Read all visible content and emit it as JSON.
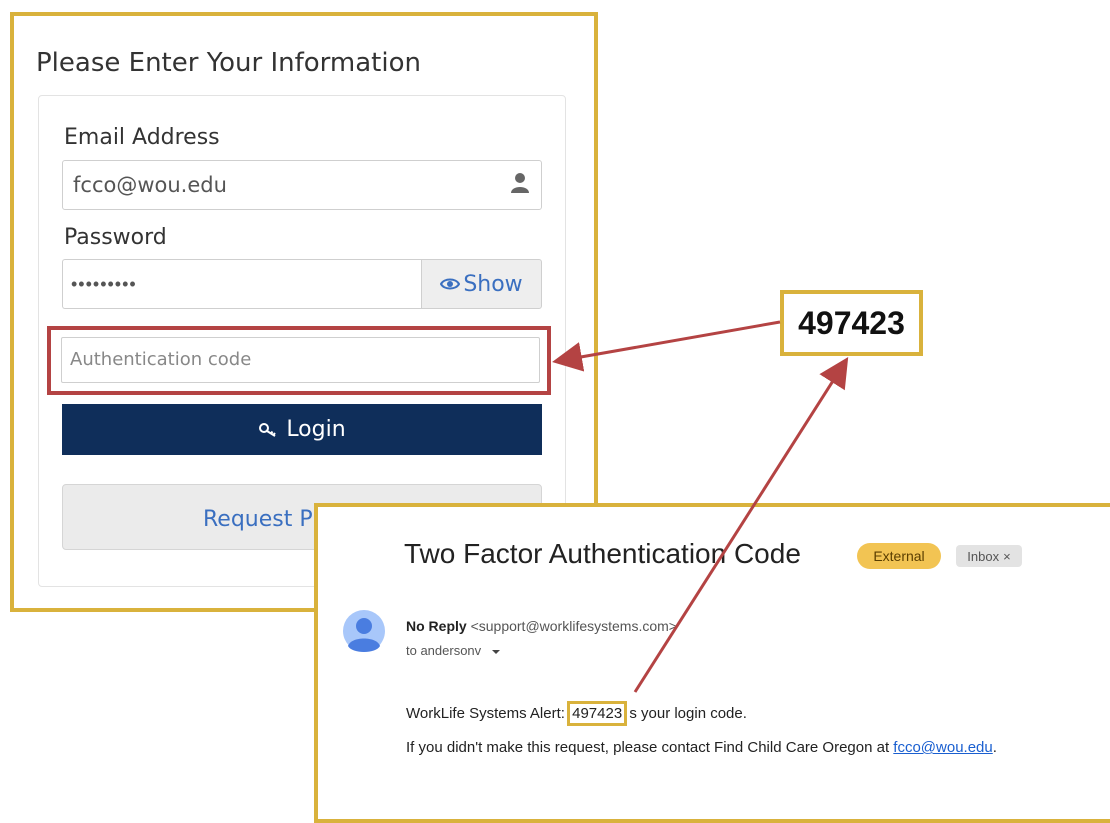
{
  "login_form": {
    "title": "Please Enter Your Information",
    "email_label": "Email Address",
    "email_value": "fcco@wou.edu",
    "password_label": "Password",
    "password_value": "•••••••••",
    "show_button_label": "Show",
    "auth_code_placeholder": "Authentication code",
    "login_button_label": "Login",
    "request_button_label": "Request P"
  },
  "callout": {
    "code": "497423"
  },
  "email": {
    "subject": "Two Factor Authentication Code",
    "external_badge": "External",
    "inbox_badge": "Inbox",
    "inbox_close": "×",
    "sender_name": "No Reply",
    "sender_address": "<support@worklifesystems.com>",
    "recipient": "to andersonv",
    "alert_prefix": "WorkLife Systems Alert: ",
    "code": "497423",
    "alert_suffix": " s your login code.",
    "contact_text": "If you didn't make this request, please contact Find Child Care Oregon at ",
    "contact_link": "fcco@wou.edu",
    "contact_end": "."
  },
  "colors": {
    "highlight_gold": "#d9b23c",
    "highlight_red": "#b44343",
    "login_button": "#0f2e5a",
    "link_blue": "#1a5fd0"
  },
  "icons": [
    "user-icon",
    "eye-icon",
    "key-icon",
    "avatar-icon",
    "chevron-down-icon"
  ]
}
